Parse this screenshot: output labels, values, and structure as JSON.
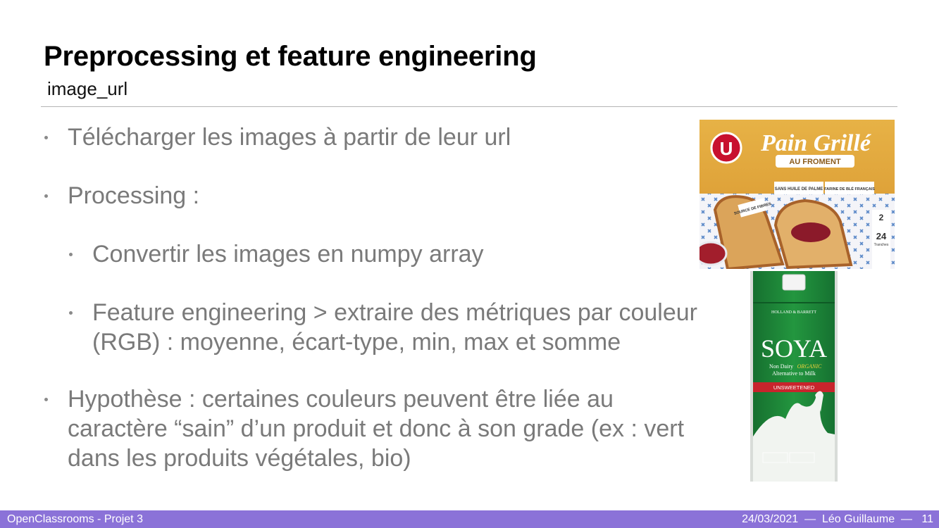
{
  "slide": {
    "title": "Preprocessing et feature engineering",
    "subtitle": "image_url",
    "bullets": [
      "Télécharger les images à partir de leur url",
      "Processing :",
      "Convertir les images en numpy array",
      "Feature engineering > extraire des métriques par couleur (RGB) : moyenne, écart-type, min, max et somme",
      "Hypothèse : certaines couleurs peuvent être liée au caractère “sain” d’un produit et donc à son grade (ex : vert dans les produits végétales, bio)"
    ]
  },
  "images": {
    "pain": {
      "brand": "U",
      "name": "Pain Grillé",
      "variant": "AU FROMENT",
      "claim1": "SANS HUILE DE PALME",
      "claim2": "FARINE DE BLÉ FRANÇAIS",
      "badge": "SOURCE DE FIBRES",
      "count1": "2",
      "count2": "24",
      "count2_label": "Tranches"
    },
    "soya": {
      "brand": "HOLLAND & BARRETT",
      "name": "SOYA",
      "line1": "Non Dairy",
      "line1_accent": "ORGANIC",
      "line2": "Alternative to Milk",
      "band": "UNSWEETENED"
    }
  },
  "footer": {
    "left": "OpenClassrooms - Projet 3",
    "date": "24/03/2021",
    "author": "Léo Guillaume",
    "page": "11"
  },
  "colors": {
    "footer_bg": "#8b72d8",
    "body_text": "#7a7a7a",
    "pain_bg": "#e0a43a",
    "soya_green": "#1f8a3c"
  }
}
